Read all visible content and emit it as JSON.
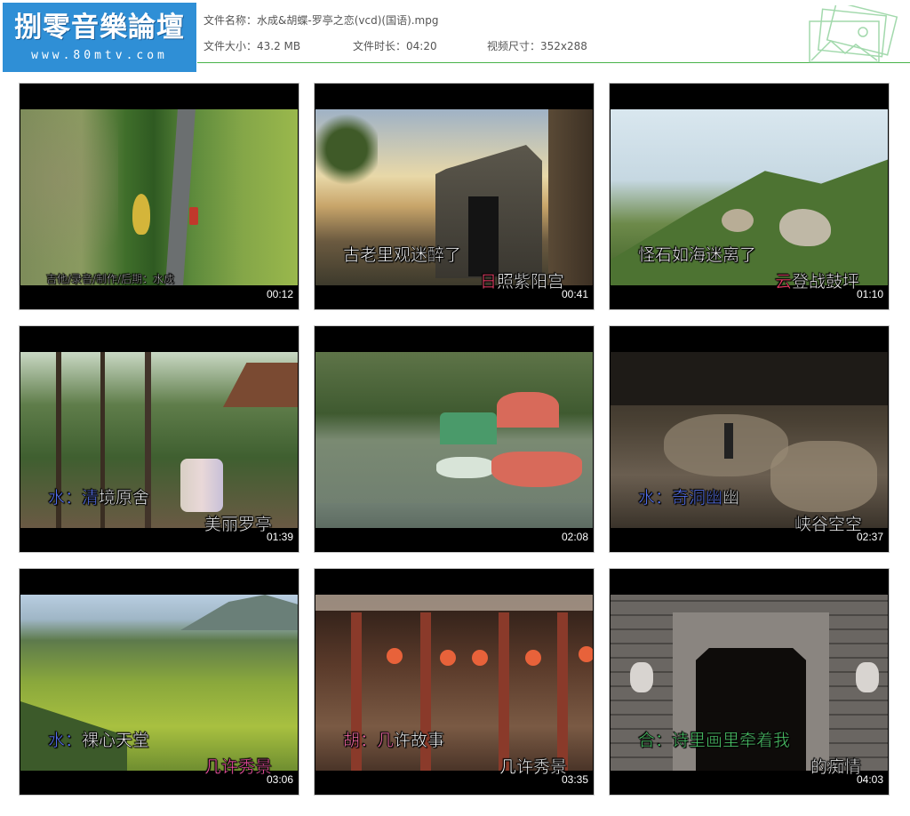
{
  "header": {
    "logo_title": "捌零音樂論壇",
    "logo_url": "www.80mtv.com",
    "file_name_label": "文件名称：",
    "file_name": "水成&胡蝶-罗亭之恋(vcd)(国语).mpg",
    "file_size_label": "文件大小：",
    "file_size": "43.2 MB",
    "duration_label": "文件时长：",
    "duration": "04:20",
    "resolution_label": "视频尺寸：",
    "resolution": "352x288"
  },
  "thumbnails": [
    {
      "time": "00:12",
      "credit": "吉他/录音/制作/后期：水成"
    },
    {
      "time": "00:41",
      "line1": "古老里观迷醉了",
      "line2_hl": "日",
      "line2": "照紫阳宫"
    },
    {
      "time": "01:10",
      "line1": "怪石如海迷离了",
      "line2_hl": "云",
      "line2": "登战鼓坪"
    },
    {
      "time": "01:39",
      "line1_prefix": "水：",
      "line1_hl": "清",
      "line1": "境原舍",
      "line2": "美丽罗亭"
    },
    {
      "time": "02:08"
    },
    {
      "time": "02:37",
      "line1_prefix": "水：",
      "line1_hl": "奇洞幽",
      "line1": "幽",
      "line2": "峡谷空空"
    },
    {
      "time": "03:06",
      "line1_prefix": "水：",
      "line1": "裸心天堂",
      "line2": "几许秀景"
    },
    {
      "time": "03:35",
      "line1_prefix": "胡：",
      "line1_hl": "几",
      "line1": "许故事",
      "line2": "几许秀景"
    },
    {
      "time": "04:03",
      "line1_prefix": "合：",
      "line1": "诗里画里牵着我",
      "line2": "的痴情"
    }
  ],
  "colors": {
    "logo_bg": "#2f8fd6",
    "rule": "#49b34a",
    "subtitle_highlight": "#ff3c6a",
    "prefix_blue": "#5a78ff",
    "prefix_pink": "#ff6aa8",
    "prefix_green": "#4bd06a"
  }
}
